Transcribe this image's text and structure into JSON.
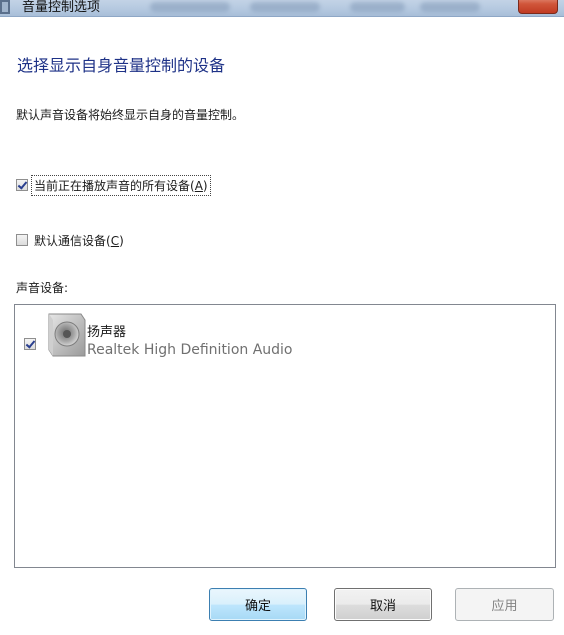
{
  "window": {
    "title": "音量控制选项"
  },
  "main": {
    "heading": "选择显示自身音量控制的设备",
    "description": "默认声音设备将始终显示自身的音量控制。",
    "options": [
      {
        "label": "当前正在播放声音的所有设备",
        "accel_prefix": "(",
        "accel": "A",
        "accel_suffix": ")",
        "checked": true
      },
      {
        "label": "默认通信设备",
        "accel_prefix": "(",
        "accel": "C",
        "accel_suffix": ")",
        "checked": false
      }
    ],
    "devices_label": "声音设备:",
    "devices": [
      {
        "name": "扬声器",
        "description": "Realtek High Definition Audio",
        "checked": true,
        "icon": "speaker-icon"
      }
    ]
  },
  "buttons": {
    "ok": "确定",
    "cancel": "取消",
    "apply": "应用"
  },
  "colors": {
    "heading": "#1e3287",
    "ok_border": "#3c7fb1"
  }
}
